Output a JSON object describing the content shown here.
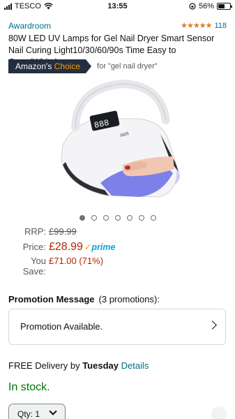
{
  "status_bar": {
    "carrier": "TESCO",
    "time": "13:55",
    "battery_percent": "56%",
    "battery_level": 0.56
  },
  "product": {
    "brand": "Awardroom",
    "rating_stars": "★★★★★",
    "rating_value": 4.5,
    "rating_count": "118",
    "title": "80W LED UV Lamps for Gel Nail Dryer Smart Sensor Nail Curing Light10/30/60/90s Time Easy to Carry(White)…"
  },
  "badge": {
    "label_prefix": "Amazon's ",
    "label_accent": "Choice",
    "for_text": "for \"gel nail dryer\""
  },
  "gallery": {
    "image_count": 7,
    "active_index": 0,
    "image_icon": "uv-nail-lamp-image"
  },
  "pricing": {
    "rrp_label": "RRP:",
    "rrp_value": "£99.99",
    "price_label": "Price:",
    "price_value": "£28.99",
    "prime_label": "prime",
    "save_label": "You Save:",
    "save_value": "£71.00 (71%)"
  },
  "promotion": {
    "heading": "Promotion Message",
    "count": "(3 promotions):",
    "box_text": "Promotion Available."
  },
  "delivery": {
    "prefix": "FREE Delivery by ",
    "day": "Tuesday",
    "link": "Details"
  },
  "stock": {
    "status": "In stock."
  },
  "quantity": {
    "label": "Qty: 1"
  },
  "colors": {
    "link": "#007185",
    "price": "#b12704",
    "stock": "#007600",
    "star": "#de7921",
    "badge_bg": "#232f3e",
    "badge_accent": "#ff9900",
    "prime": "#00a8e1"
  }
}
